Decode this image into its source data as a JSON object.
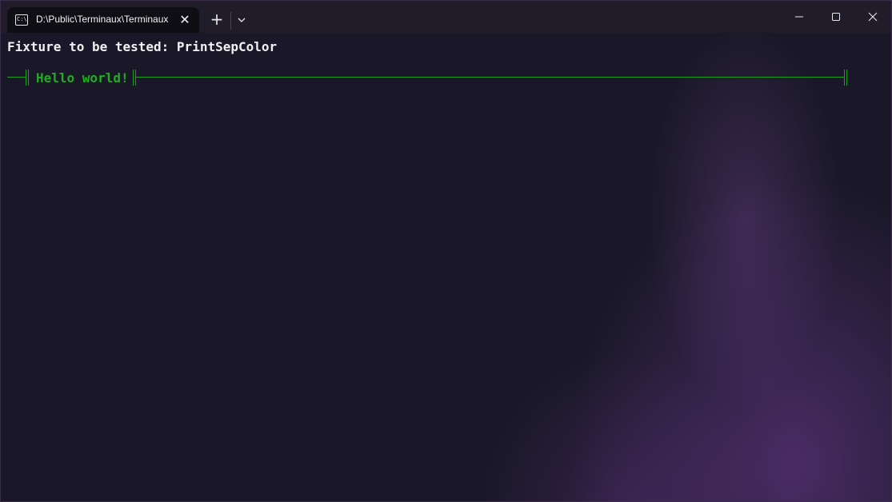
{
  "tab": {
    "title": "D:\\Public\\Terminaux\\Terminaux",
    "icon": "terminal-icon",
    "icon_glyph": "C:\\",
    "close_glyph": "✕"
  },
  "titlebar": {
    "new_tab_glyph": "+",
    "dropdown_icon": "chevron-down-icon",
    "minimize_icon": "minimize-icon",
    "maximize_icon": "maximize-icon",
    "close_icon": "close-icon"
  },
  "terminal": {
    "line1": "Fixture to be tested: PrintSepColor",
    "separator_text": "Hello world!",
    "separator_color": "#1aa31a",
    "text_color": "#f0f0f0",
    "background": "#1a1828"
  }
}
